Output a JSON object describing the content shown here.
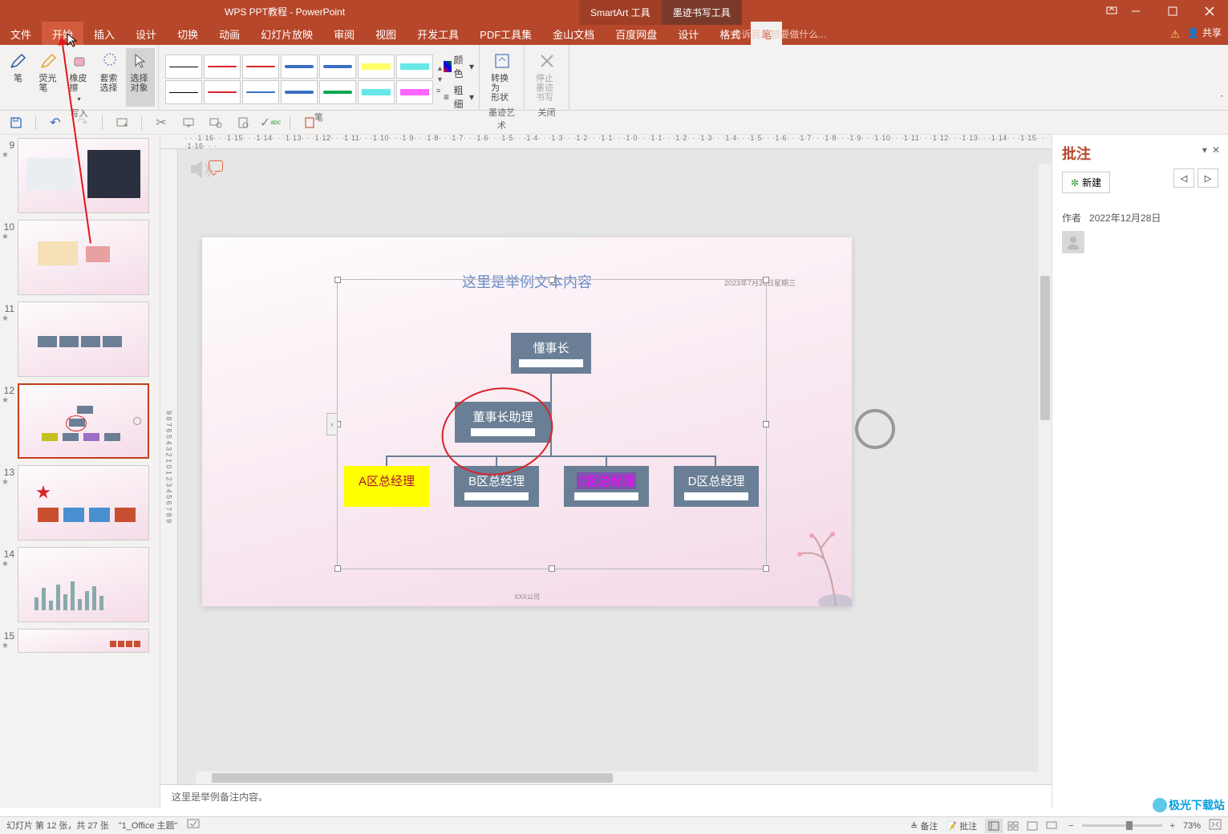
{
  "window": {
    "title": "WPS PPT教程 - PowerPoint",
    "context_tab1": "SmartArt 工具",
    "context_tab2": "墨迹书写工具"
  },
  "menu": {
    "file": "文件",
    "home": "开始",
    "insert": "插入",
    "design": "设计",
    "transitions": "切换",
    "animations": "动画",
    "slideshow": "幻灯片放映",
    "review": "审阅",
    "view": "视图",
    "developer": "开发工具",
    "pdf_tools": "PDF工具集",
    "wps_docs": "金山文档",
    "baidu_disk": "百度网盘",
    "design2": "设计",
    "format": "格式",
    "pen": "笔",
    "tell_me": "告诉我您想要做什么...",
    "share": "共享"
  },
  "ribbon": {
    "group_write": "写入",
    "group_pens": "笔",
    "group_inkart": "墨迹艺术",
    "group_close": "关闭",
    "btn_pen": "笔",
    "btn_highlighter": "荧光笔",
    "btn_eraser": "橡皮擦",
    "btn_lasso": "套索选择",
    "btn_select": "选择对象",
    "btn_color": "颜色",
    "btn_thickness": "粗细",
    "btn_convert_shape": "转换为\n形状",
    "btn_stop_ink": "停止\n墨迹书写",
    "pen_colors_row1": [
      "#000000",
      "#d8232a",
      "#d8232a",
      "#3a6fc4",
      "#3a6fc4",
      "#ffff00",
      "#00d8d8"
    ],
    "pen_colors_row2": [
      "#000000",
      "#d8232a",
      "#3a6fc4",
      "#3a6fc4",
      "#00a850",
      "#00d8d8",
      "#ff00ff"
    ]
  },
  "slides": {
    "numbers": [
      "9",
      "10",
      "11",
      "12",
      "13",
      "14",
      "15"
    ],
    "current": 12
  },
  "slide_content": {
    "title": "这里是举例文本内容",
    "date": "2023年7月28日星期三",
    "footer": "XXX公司",
    "org": {
      "top": "懂事长",
      "assistant": "董事长助理",
      "a": "A区总经理",
      "b": "B区总经理",
      "c": "C区总经理",
      "d": "D区总经理"
    }
  },
  "notes": {
    "text": "这里是举例备注内容。"
  },
  "comments": {
    "title": "批注",
    "new_btn": "新建",
    "author_label": "作者",
    "date": "2022年12月28日"
  },
  "ruler": {
    "h": "· · ·1·16· · ·1·15· · ·1·14· · ·1·13· · ·1·12· · ·1·11· · ·1·10· · ·1·9· · ·1·8· · ·1·7· · ·1·6· · ·1·5· · ·1·4· · ·1·3· · ·1·2· · ·1·1· · ·1·0· · ·1·1· · ·1·2· · ·1·3· · ·1·4· · ·1·5· · ·1·6· · ·1·7· · ·1·8· · ·1·9· · ·1·10· · ·1·11· · ·1·12· · ·1·13· · ·1·14· · ·1·15· · ·1·16· · ·",
    "v": "9 8 7 6 5 4 3 2 1 0 1 2 3 4 5 6 7 8 9"
  },
  "status": {
    "slide_info": "幻灯片 第 12 张，共 27 张",
    "theme": "\"1_Office 主题\"",
    "notes_btn": "备注",
    "comments_btn": "批注",
    "zoom": "73%"
  },
  "watermark": "极光下载站"
}
